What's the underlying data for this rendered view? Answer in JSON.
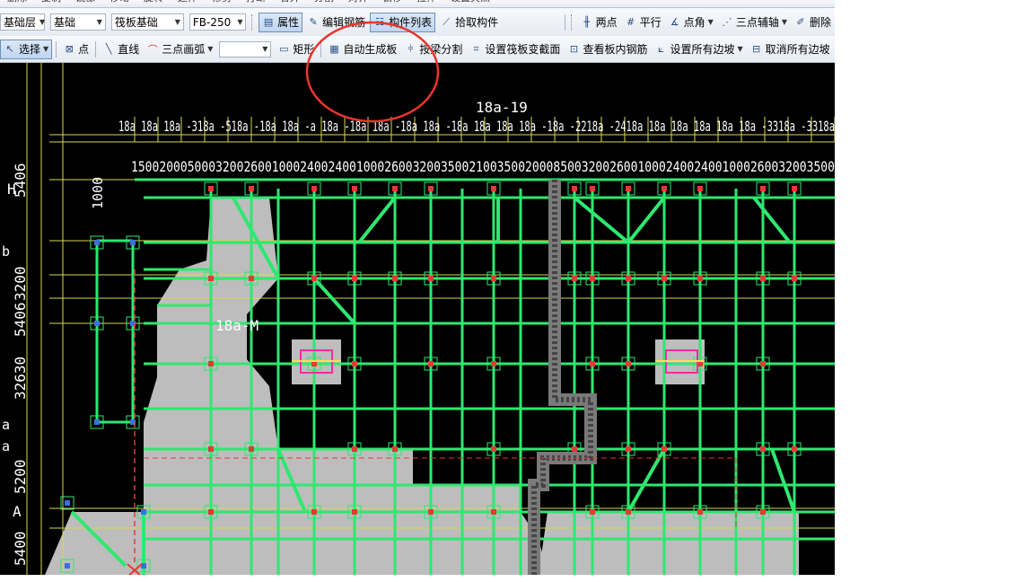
{
  "toolbar_top": {
    "items": [
      "删除",
      "复制",
      "镜像",
      "移动",
      "旋转",
      "延伸",
      "修剪",
      "打断",
      "合并",
      "分割",
      "对齐",
      "偏移",
      "拉伸",
      "设置夹点"
    ]
  },
  "toolbar_row1": {
    "floor_select": "基础层",
    "category_select": "基础",
    "type_select": "筏板基础",
    "component_select": "FB-250",
    "properties_btn": "属性",
    "edit_rebar_btn": "编辑钢筋",
    "component_list_btn": "构件列表",
    "pick_component_btn": "拾取构件",
    "two_points_btn": "两点",
    "parallel_btn": "平行",
    "point_angle_btn": "点角",
    "three_point_axis_btn": "三点辅轴",
    "delete_btn": "删除"
  },
  "toolbar_row2": {
    "select_btn": "选择",
    "point_btn": "点",
    "line_btn": "直线",
    "arc_btn": "三点画弧",
    "arc_option_select": "",
    "rect_btn": "矩形",
    "auto_generate_btn": "自动生成板",
    "split_by_beam_btn": "按梁分割",
    "set_raft_section_btn": "设置筏板变截面",
    "view_rebar_btn": "查看板内钢筋",
    "set_all_slope_btn": "设置所有边坡",
    "cancel_all_slope_btn": "取消所有边坡"
  },
  "cad": {
    "top_axis_labels": "18a 18a 18a -318a -518a -18a 18a -a 18a -18a 18a -18a 18a -18a 18a 18a 18a -18a -2218a -2418a 18a 18a 18a 18a 18a -3318a -3318a",
    "top_axis_label_main": "18a-19",
    "top_dims": [
      "1500",
      "2000",
      "5000",
      "3200",
      "2600",
      "1000",
      "2400",
      "2400",
      "1000",
      "2600",
      "3200",
      "3500",
      "2100",
      "3500",
      "2000",
      "8500",
      "3200",
      "2600",
      "1000",
      "2400",
      "2400",
      "1000",
      "2600",
      "3200",
      "3500"
    ],
    "left_dim_vertical": "1000",
    "left_axis_H": "H",
    "left_axis_A": "A",
    "left_dims": [
      "5406",
      "3200",
      "5406",
      "32630",
      "5200",
      "5400"
    ],
    "left_col_labels": [
      "b",
      "a",
      "a"
    ],
    "mid_label": "18a-M",
    "colors": {
      "member": "#2ee870",
      "raft": "#bdbdbd",
      "grid": "#d8d850",
      "highlight": "#e53935",
      "accent": "#ff2aa0"
    }
  }
}
